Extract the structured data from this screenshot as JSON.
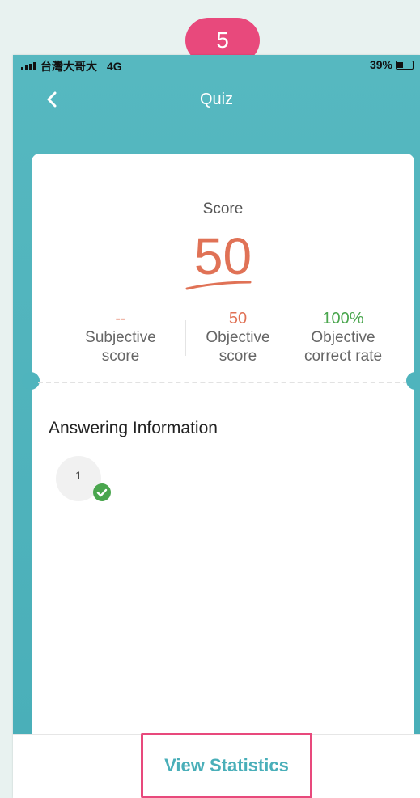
{
  "status_bar": {
    "carrier": "台灣大哥大",
    "network": "4G",
    "battery": "39%"
  },
  "nav": {
    "title": "Quiz"
  },
  "tutorial": {
    "step": "5"
  },
  "score": {
    "label": "Score",
    "value": "50",
    "accent_color": "#e07256"
  },
  "stats": [
    {
      "value": "--",
      "label": "Subjective\nscore",
      "color": "#e07256"
    },
    {
      "value": "50",
      "label": "Objective\nscore",
      "color": "#e07256"
    },
    {
      "value": "100%",
      "label": "Objective\ncorrect rate",
      "color": "#4aa64e"
    }
  ],
  "answering": {
    "title": "Answering Information",
    "questions": [
      {
        "number": "1",
        "status": "correct"
      }
    ]
  },
  "footer": {
    "view_statistics": "View Statistics"
  },
  "colors": {
    "teal": "#4aafb9",
    "highlight": "#e8497c",
    "correct": "#4aa64e"
  }
}
